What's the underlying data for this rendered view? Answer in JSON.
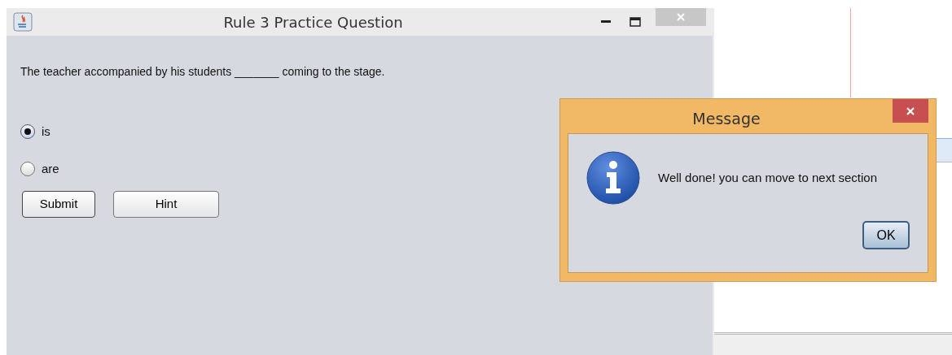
{
  "window": {
    "title": "Rule 3 Practice Question"
  },
  "question": "The teacher accompanied by his students _______ coming to the stage.",
  "options": [
    {
      "label": "is",
      "selected": true
    },
    {
      "label": "are",
      "selected": false
    }
  ],
  "buttons": [
    {
      "label": "Submit"
    },
    {
      "label": "Hint"
    }
  ],
  "dialog": {
    "title": "Message",
    "message": "Well done! you can move to next section",
    "button": "OK"
  }
}
